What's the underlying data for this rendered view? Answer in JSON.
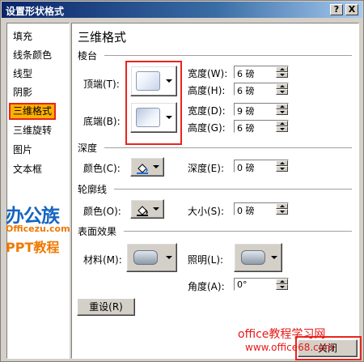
{
  "window": {
    "title": "设置形状格式",
    "help_button": "?",
    "close_button": "X"
  },
  "sidebar": {
    "items": [
      {
        "label": "填充"
      },
      {
        "label": "线条颜色"
      },
      {
        "label": "线型"
      },
      {
        "label": "阴影"
      },
      {
        "label": "三维格式"
      },
      {
        "label": "三维旋转"
      },
      {
        "label": "图片"
      },
      {
        "label": "文本框"
      }
    ],
    "selected": "三维格式"
  },
  "panel": {
    "title": "三维格式",
    "bevel": {
      "section": "棱台",
      "top_label": "顶端(T):",
      "bottom_label": "底端(B):",
      "top_width_label": "宽度(W):",
      "top_width_value": "6 磅",
      "top_height_label": "高度(H):",
      "top_height_value": "6 磅",
      "bottom_width_label": "宽度(D):",
      "bottom_width_value": "9 磅",
      "bottom_height_label": "高度(G):",
      "bottom_height_value": "6 磅"
    },
    "depth": {
      "section": "深度",
      "color_label": "颜色(C):",
      "depth_label": "深度(E):",
      "depth_value": "0 磅"
    },
    "contour": {
      "section": "轮廓线",
      "color_label": "颜色(O):",
      "size_label": "大小(S):",
      "size_value": "0 磅"
    },
    "surface": {
      "section": "表面效果",
      "material_label": "材料(M):",
      "lighting_label": "照明(L):",
      "angle_label": "角度(A):",
      "angle_value": "0°"
    },
    "reset_button": "重设(R)"
  },
  "footer": {
    "close_button": "关闭"
  },
  "watermarks": {
    "brand_cn": "办公族",
    "brand_url": "Officezu.com",
    "ppt_text": "PPT教程",
    "site_name": "office教程学习网",
    "site_url": "www.office68.com"
  },
  "colors": {
    "titlebar": "#0a246a",
    "selection": "#ffb100",
    "highlight_box": "#e8251c"
  }
}
